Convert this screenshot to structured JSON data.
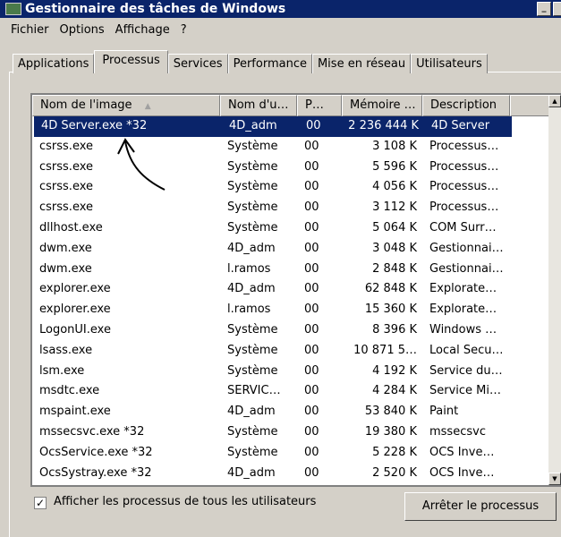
{
  "window": {
    "title": "Gestionnaire des tâches de Windows",
    "min_label": "_"
  },
  "menu": [
    "Fichier",
    "Options",
    "Affichage",
    "?"
  ],
  "tabs": [
    "Applications",
    "Processus",
    "Services",
    "Performance",
    "Mise en réseau",
    "Utilisateurs"
  ],
  "active_tab": "Processus",
  "columns": [
    "Nom de l'image",
    "Nom d'u…",
    "P…",
    "Mémoire …",
    "Description"
  ],
  "sort_indicator": "▲",
  "rows": [
    [
      "4D Server.exe *32",
      "4D_adm",
      "00",
      "2 236 444 K",
      "4D Server"
    ],
    [
      "csrss.exe",
      "Système",
      "00",
      "3 108 K",
      "Processus…"
    ],
    [
      "csrss.exe",
      "Système",
      "00",
      "5 596 K",
      "Processus…"
    ],
    [
      "csrss.exe",
      "Système",
      "00",
      "4 056 K",
      "Processus…"
    ],
    [
      "csrss.exe",
      "Système",
      "00",
      "3 112 K",
      "Processus…"
    ],
    [
      "dllhost.exe",
      "Système",
      "00",
      "5 064 K",
      "COM Surr…"
    ],
    [
      "dwm.exe",
      "4D_adm",
      "00",
      "3 048 K",
      "Gestionnai…"
    ],
    [
      "dwm.exe",
      "l.ramos",
      "00",
      "2 848 K",
      "Gestionnai…"
    ],
    [
      "explorer.exe",
      "4D_adm",
      "00",
      "62 848 K",
      "Explorate…"
    ],
    [
      "explorer.exe",
      "l.ramos",
      "00",
      "15 360 K",
      "Explorate…"
    ],
    [
      "LogonUI.exe",
      "Système",
      "00",
      "8 396 K",
      "Windows …"
    ],
    [
      "lsass.exe",
      "Système",
      "00",
      "10 871 5…",
      "Local Secu…"
    ],
    [
      "lsm.exe",
      "Système",
      "00",
      "4 192 K",
      "Service du…"
    ],
    [
      "msdtc.exe",
      "SERVIC…",
      "00",
      "4 284 K",
      "Service Mi…"
    ],
    [
      "mspaint.exe",
      "4D_adm",
      "00",
      "53 840 K",
      "Paint"
    ],
    [
      "mssecsvc.exe *32",
      "Système",
      "00",
      "19 380 K",
      "mssecsvc"
    ],
    [
      "OcsService.exe *32",
      "Système",
      "00",
      "5 228 K",
      "OCS Inve…"
    ],
    [
      "OcsSystray.exe *32",
      "4D_adm",
      "00",
      "2 520 K",
      "OCS Inve…"
    ]
  ],
  "show_all_users": {
    "label": "Afficher les processus de tous les utilisateurs",
    "checked": true,
    "mark": "✓"
  },
  "end_process_label": "Arrêter le processus"
}
